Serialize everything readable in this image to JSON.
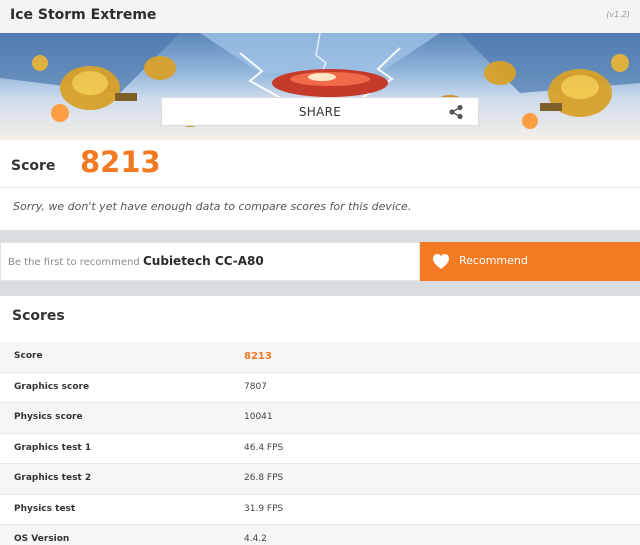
{
  "header": {
    "title": "Ice Storm Extreme",
    "version": "(v1.2)"
  },
  "share": {
    "label": "SHARE",
    "icon": "share-icon"
  },
  "score": {
    "label": "Score",
    "value": "8213",
    "message": "Sorry, we don't yet have enough data to compare scores for this device."
  },
  "recommend": {
    "hint": "Be the first to recommend",
    "device": "Cubietech CC-A80",
    "button_label": "Recommend",
    "icon": "heart-icon"
  },
  "scores": {
    "heading": "Scores",
    "rows": [
      {
        "label": "Score",
        "value": "8213"
      },
      {
        "label": "Graphics score",
        "value": "7807"
      },
      {
        "label": "Physics score",
        "value": "10041"
      },
      {
        "label": "Graphics test 1",
        "value": "46.4 FPS"
      },
      {
        "label": "Graphics test 2",
        "value": "26.8 FPS"
      },
      {
        "label": "Physics test",
        "value": "31.9 FPS"
      },
      {
        "label": "OS Version",
        "value": "4.4.2"
      }
    ]
  },
  "colors": {
    "accent": "#f27b22",
    "recommend_bg": "#f47a24"
  }
}
